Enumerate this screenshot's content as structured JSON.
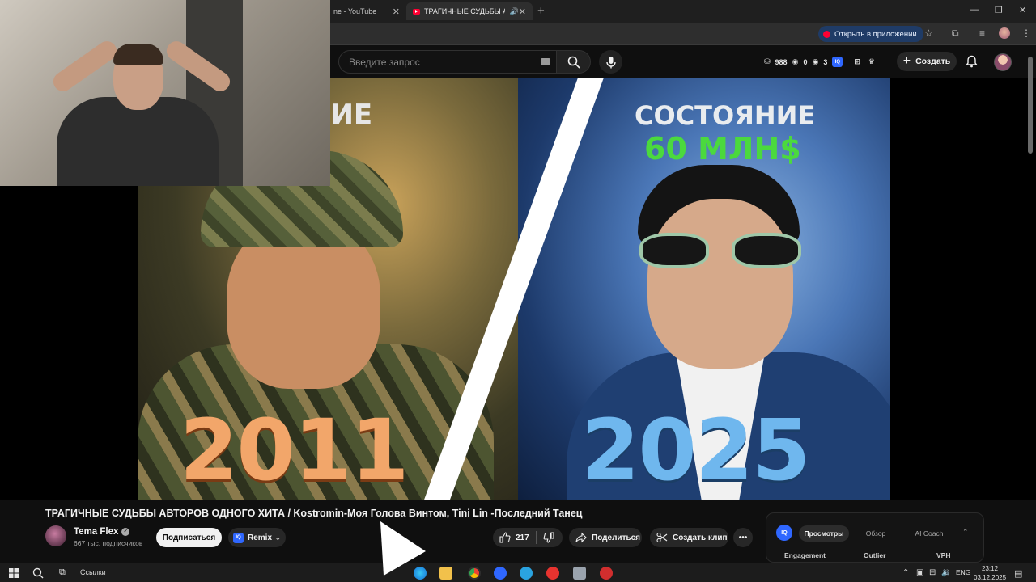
{
  "browser": {
    "tabs": [
      {
        "label": "ne - YouTube"
      },
      {
        "label": "ТРАГИЧНЫЕ СУДЬБЫ АВТО"
      }
    ],
    "open_in_app": "Открыть в приложении"
  },
  "youtube": {
    "search_placeholder": "Введите запрос",
    "stats": {
      "a": "988",
      "b": "0",
      "c": "3"
    },
    "create_label": "Создать"
  },
  "thumbnail": {
    "left_headline": "НИЕ",
    "left_year": "2011",
    "right_headline": "СОСТОЯНИЕ",
    "right_money": "60 МЛН$",
    "right_year": "2025"
  },
  "video": {
    "title": "ТРАГИЧНЫЕ СУДЬБЫ АВТОРОВ ОДНОГО ХИТА / Kostromin-Моя Голова Винтом, Tini Lin -Последний Танец",
    "channel": "Tema Flex",
    "subscribers": "667 тыс. подписчиков",
    "subscribe_label": "Подписаться",
    "remix_label": "Remix",
    "likes": "217",
    "share_label": "Поделиться",
    "clip_label": "Создать клип"
  },
  "iq_panel": {
    "logo": "IQ",
    "tabs": [
      "Просмотры",
      "Обзор",
      "AI Coach"
    ],
    "columns": [
      "Engagement",
      "Outlier",
      "VPH"
    ]
  },
  "taskbar": {
    "links_label": "Ссылки",
    "lang": "ENG",
    "time": "23:12",
    "date": "03.12.2025"
  },
  "colors": {
    "youtube_red": "#ff0033",
    "money_green": "#4bd93e",
    "year_left": "#f2a66a",
    "year_right": "#6fb7ee",
    "iq_blue": "#2f67ff"
  }
}
